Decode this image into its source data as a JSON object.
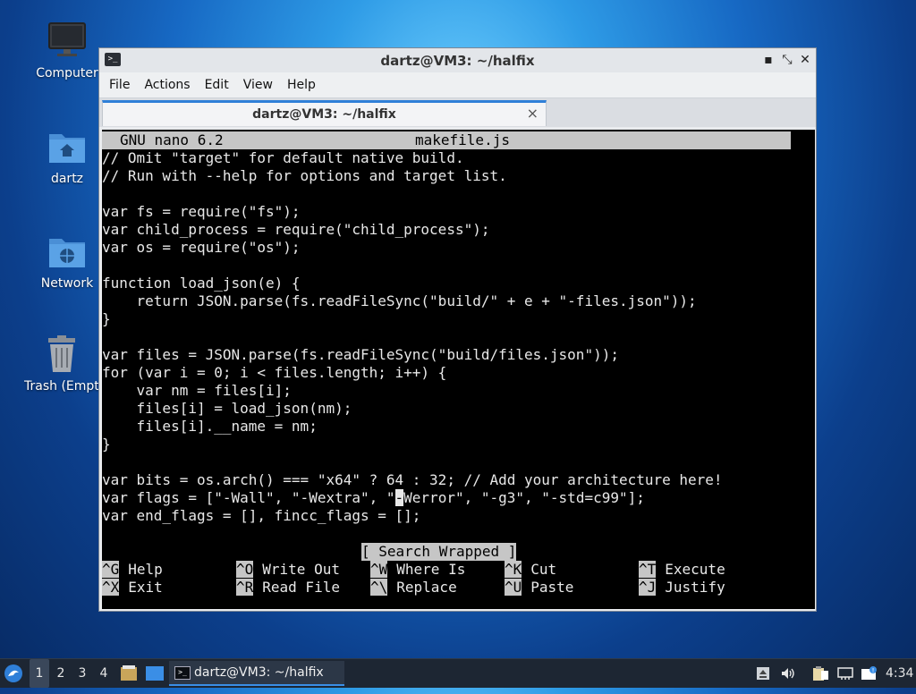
{
  "desktop": {
    "icons": [
      {
        "label": "Computer",
        "icon": "computer-icon"
      },
      {
        "label": "dartz",
        "icon": "home-folder-icon"
      },
      {
        "label": "Network",
        "icon": "network-folder-icon"
      },
      {
        "label": "Trash (Empty)",
        "icon": "trash-icon"
      }
    ]
  },
  "window": {
    "title": "dartz@VM3: ~/halfix",
    "controls": {
      "minimize": "▪",
      "restore": "⤡",
      "close": "✕"
    },
    "menu": [
      "File",
      "Actions",
      "Edit",
      "View",
      "Help"
    ],
    "tab": {
      "label": "dartz@VM3: ~/halfix",
      "close": "×"
    }
  },
  "nano": {
    "app": "GNU nano 6.2",
    "filename": "makefile.js",
    "lines": [
      "// Omit \"target\" for default native build.",
      "// Run with --help for options and target list.",
      "",
      "var fs = require(\"fs\");",
      "var child_process = require(\"child_process\");",
      "var os = require(\"os\");",
      "",
      "function load_json(e) {",
      "    return JSON.parse(fs.readFileSync(\"build/\" + e + \"-files.json\"));",
      "}",
      "",
      "var files = JSON.parse(fs.readFileSync(\"build/files.json\"));",
      "for (var i = 0; i < files.length; i++) {",
      "    var nm = files[i];",
      "    files[i] = load_json(nm);",
      "    files[i].__name = nm;",
      "}",
      "",
      "var bits = os.arch() === \"x64\" ? 64 : 32; // Add your architecture here!"
    ],
    "flags_line": {
      "before": "var flags = [\"-Wall\", \"-Wextra\", \"",
      "cursor_char": "-",
      "after": "Werror\", \"-g3\", \"-std=c99\"];"
    },
    "last_line": "var end_flags = [], fincc_flags = [];",
    "status": "[ Search Wrapped ]",
    "shortcuts": [
      [
        {
          "key": "^G",
          "label": "Help"
        },
        {
          "key": "^O",
          "label": "Write Out"
        },
        {
          "key": "^W",
          "label": "Where Is"
        },
        {
          "key": "^K",
          "label": "Cut"
        },
        {
          "key": "^T",
          "label": "Execute"
        }
      ],
      [
        {
          "key": "^X",
          "label": "Exit"
        },
        {
          "key": "^R",
          "label": "Read File"
        },
        {
          "key": "^\\",
          "label": "Replace"
        },
        {
          "key": "^U",
          "label": "Paste"
        },
        {
          "key": "^J",
          "label": "Justify"
        }
      ]
    ]
  },
  "taskbar": {
    "workspaces": [
      "1",
      "2",
      "3",
      "4"
    ],
    "active_workspace": "1",
    "task": {
      "label": "dartz@VM3: ~/halfix"
    },
    "clock": "4:34"
  }
}
